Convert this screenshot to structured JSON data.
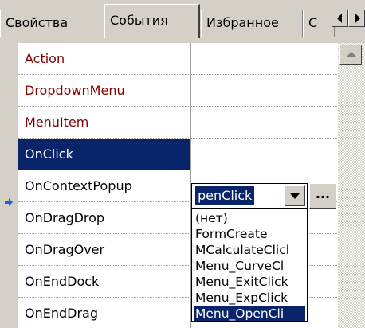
{
  "tabs": [
    {
      "label": "Свойства",
      "active": false
    },
    {
      "label": "События",
      "active": true
    },
    {
      "label": "Избранное",
      "active": false
    },
    {
      "label": "С",
      "active": false
    }
  ],
  "rows": [
    {
      "name": "Action",
      "value": "",
      "kind": "prop"
    },
    {
      "name": "DropdownMenu",
      "value": "",
      "kind": "prop"
    },
    {
      "name": "MenuItem",
      "value": "",
      "kind": "prop"
    },
    {
      "name": "OnClick",
      "value": "penClick",
      "kind": "event",
      "selected": true
    },
    {
      "name": "OnContextPopup",
      "value": "",
      "kind": "event"
    },
    {
      "name": "OnDragDrop",
      "value": "",
      "kind": "event"
    },
    {
      "name": "OnDragOver",
      "value": "",
      "kind": "event"
    },
    {
      "name": "OnEndDock",
      "value": "",
      "kind": "event"
    },
    {
      "name": "OnEndDrag",
      "value": "",
      "kind": "event"
    }
  ],
  "editor": {
    "text": "penClick",
    "ellipsis": "..."
  },
  "dropdown": {
    "items": [
      "(нет)",
      "FormCreate",
      "MCalculateClicl",
      "Menu_CurveCl",
      "Menu_ExitClick",
      "Menu_ExpClick",
      "Menu_OpenCli"
    ],
    "selected_index": 6
  },
  "icons": {
    "tab_scroll_left": "triangle-left-icon",
    "tab_scroll_right": "triangle-right-icon",
    "scroll_up": "triangle-up-icon",
    "current_row": "arrow-right-icon",
    "dropdown": "triangle-down-icon"
  },
  "colors": {
    "selection": "#0a246a",
    "property_name": "#800000",
    "face": "#d4d0c8",
    "row_marker": "#1e64d8"
  }
}
